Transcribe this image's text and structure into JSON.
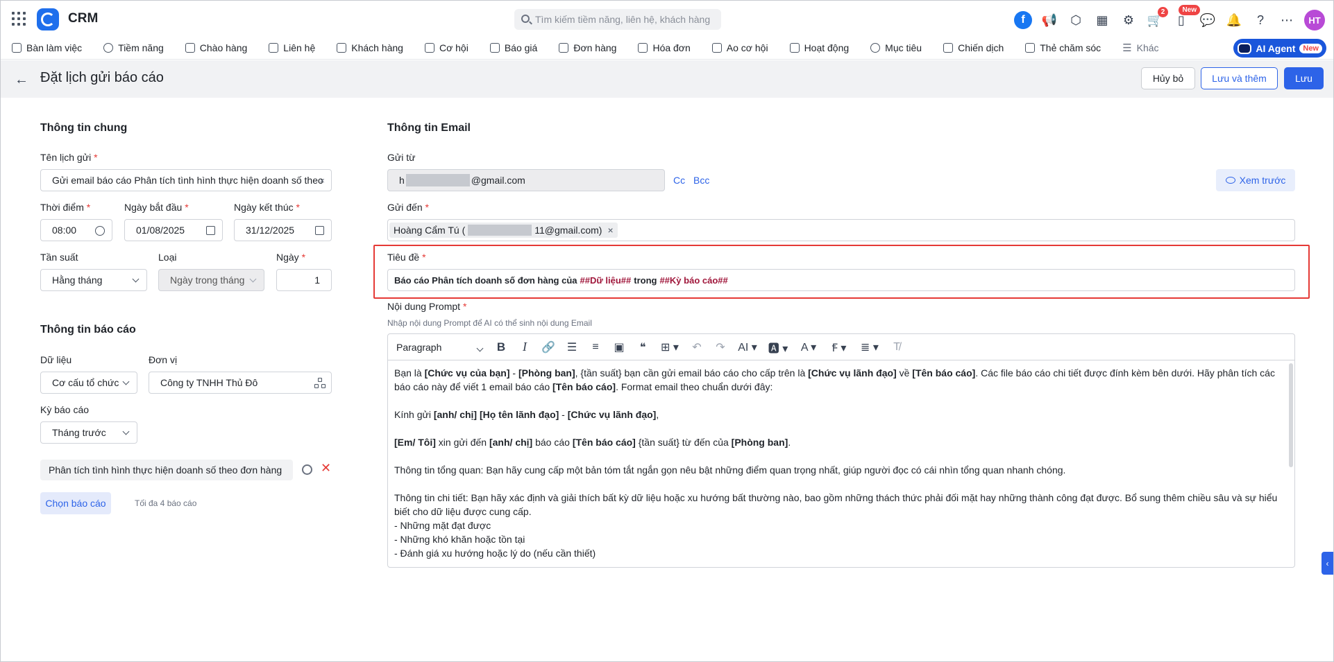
{
  "app": {
    "title": "CRM"
  },
  "search": {
    "placeholder": "Tìm kiếm tiềm năng, liên hệ, khách hàng"
  },
  "topbar": {
    "cart_badge": "2",
    "mobile_badge": "New",
    "avatar_initials": "HT"
  },
  "nav": {
    "items": [
      {
        "label": "Bàn làm việc"
      },
      {
        "label": "Tiềm năng"
      },
      {
        "label": "Chào hàng"
      },
      {
        "label": "Liên hệ"
      },
      {
        "label": "Khách hàng"
      },
      {
        "label": "Cơ hội"
      },
      {
        "label": "Báo giá"
      },
      {
        "label": "Đơn hàng"
      },
      {
        "label": "Hóa đơn"
      },
      {
        "label": "Ao cơ hội"
      },
      {
        "label": "Hoạt động"
      },
      {
        "label": "Mục tiêu"
      },
      {
        "label": "Chiến dịch"
      },
      {
        "label": "Thẻ chăm sóc"
      },
      {
        "label": "Khác"
      }
    ],
    "ai_agent": {
      "label": "AI Agent",
      "badge": "New"
    }
  },
  "header": {
    "title": "Đặt lịch gửi báo cáo",
    "cancel_label": "Hủy bỏ",
    "save_add_label": "Lưu và thêm",
    "save_label": "Lưu"
  },
  "general": {
    "title": "Thông tin chung",
    "name_label": "Tên lịch gửi",
    "name_value": "Gửi email báo cáo Phân tích tình hình thực hiện doanh số theo",
    "time_label": "Thời điểm",
    "time_value": "08:00",
    "start_label": "Ngày bắt đầu",
    "start_value": "01/08/2025",
    "end_label": "Ngày kết thúc",
    "end_value": "31/12/2025",
    "freq_label": "Tần suất",
    "freq_value": "Hằng tháng",
    "type_label": "Loại",
    "type_value": "Ngày trong tháng",
    "day_label": "Ngày",
    "day_value": "1",
    "required_mark": "*",
    "clear_mark": "×"
  },
  "report": {
    "title": "Thông tin báo cáo",
    "data_label": "Dữ liệu",
    "data_value": "Cơ cấu tổ chức",
    "unit_label": "Đơn vị",
    "unit_value": "Công ty TNHH Thủ Đô",
    "period_label": "Kỳ báo cáo",
    "period_value": "Tháng trước",
    "selected_report": "Phân tích tình hình thực hiện doanh số theo đơn hàng",
    "choose_label": "Chọn báo cáo",
    "limit_hint": "Tối đa 4 báo cáo",
    "remove_mark": "✕"
  },
  "email": {
    "title": "Thông tin Email",
    "from_label": "Gửi từ",
    "from_prefix": "h",
    "from_suffix": "@gmail.com",
    "cc_label": "Cc",
    "bcc_label": "Bcc",
    "preview_label": "Xem trước",
    "to_label": "Gửi đến",
    "recipient_prefix": "Hoàng Cẩm Tú (",
    "recipient_suffix": "11@gmail.com)",
    "subject_label": "Tiêu đề",
    "subject_part1": "Báo cáo Phân tích doanh số đơn hàng của",
    "subject_var1": "##Dữ liệu##",
    "subject_part2": "trong",
    "subject_var2": "##Kỳ báo cáo##",
    "prompt_label": "Nội dung Prompt",
    "prompt_hint": "Nhập nội dung Prompt để AI có thể sinh nội dung Email"
  },
  "editor": {
    "paragraph_label": "Paragraph",
    "lines": {
      "l1a": "Bạn là ",
      "l1b": "[Chức vụ của bạn]",
      "l1c": " - ",
      "l1d": "[Phòng ban]",
      "l1e": ", {tần suất} bạn cần gửi email báo cáo cho cấp trên là ",
      "l1f": "[Chức vụ lãnh đạo]",
      "l1g": " về ",
      "l1h": "[Tên báo cáo]",
      "l1i": ". Các file báo cáo chi tiết được đính kèm bên dưới. Hãy phân tích các báo cáo này để viết 1 email báo cáo ",
      "l1j": "[Tên báo cáo]",
      "l1k": ". Format email theo chuẩn dưới đây:",
      "l2a": "Kính gửi ",
      "l2b": "[anh/ chị] [Họ tên lãnh đạo]",
      "l2c": " - ",
      "l2d": "[Chức vụ lãnh đạo]",
      "l2e": ",",
      "l3a": "[Em/ Tôi]",
      "l3b": " xin gửi đến ",
      "l3c": "[anh/ chị]",
      "l3d": " báo cáo ",
      "l3e": "[Tên báo cáo]",
      "l3f": " {tần suất} từ đến của ",
      "l3g": "[Phòng ban]",
      "l3h": ".",
      "l4": "Thông tin tổng quan: Bạn hãy cung cấp một bản tóm tắt ngắn gọn nêu bật những điểm quan trọng nhất, giúp người đọc có cái nhìn tổng quan nhanh chóng.",
      "l5": "Thông tin chi tiết: Bạn hãy xác định và giải thích bất kỳ dữ liệu hoặc xu hướng bất thường nào, bao gồm những thách thức phải đối mặt hay những thành công đạt được. Bổ sung thêm chiều sâu và sự hiểu biết cho dữ liệu được cung cấp.",
      "l6": "- Những mặt đạt được",
      "l7": "- Những khó khăn hoặc tồn tại",
      "l8": "- Đánh giá xu hướng hoặc lý do (nếu cần thiết)"
    }
  }
}
